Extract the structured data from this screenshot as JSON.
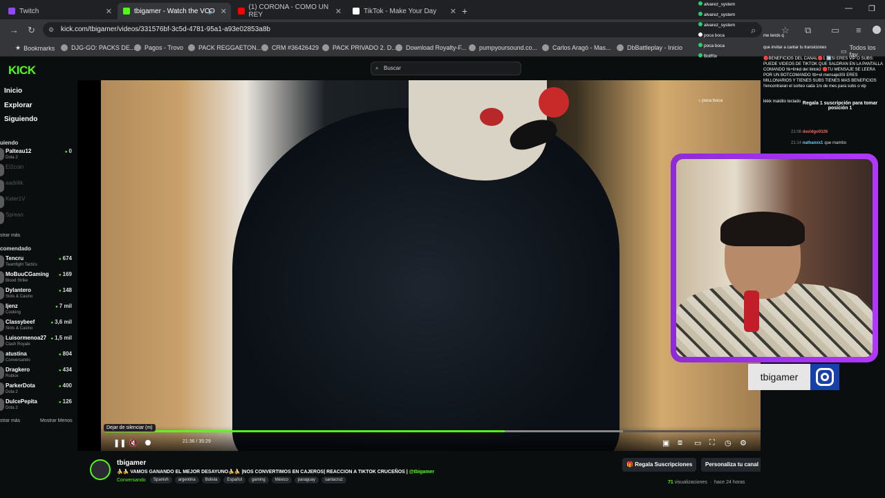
{
  "tabs": [
    {
      "label": "Twitch",
      "color": "#9146ff"
    },
    {
      "label": "tbigamer - Watch the VOD",
      "color": "#53fc18"
    },
    {
      "label": "(1) CORONA - COMO UN REY",
      "color": "#ff0000"
    },
    {
      "label": "TikTok - Make Your Day",
      "color": "#ffffff"
    }
  ],
  "address": {
    "url": "kick.com/tbigamer/videos/331576bf-3c5d-4781-95a1-a93e02853a8b"
  },
  "bookmarks": [
    "Bookmarks",
    "DJG-GO: PACKS DE...",
    "Pagos - Trovo",
    "PACK REGGAETON...",
    "CRM #36426429",
    "PACK PRIVADO 2. D...",
    "Download Royalty-F...",
    "pumpyoursound.co...",
    "Carlos Aragó - Mas...",
    "DbBattleplay - Inicio",
    "Todos los fav"
  ],
  "kick": {
    "logo": "KICK",
    "search_placeholder": "Buscar"
  },
  "sidebar": {
    "nav": [
      "Inicio",
      "Explorar",
      "Siguiendo"
    ],
    "following_header": "uiendo",
    "following": [
      {
        "name": "Palteau12",
        "game": "Dota 2",
        "viewers": "0",
        "live": true
      },
      {
        "name": "El2coin",
        "game": "",
        "viewers": "",
        "live": false
      },
      {
        "name": "aadrillk",
        "game": "",
        "viewers": "",
        "live": false
      },
      {
        "name": "Keler1V",
        "game": "",
        "viewers": "",
        "live": false
      },
      {
        "name": "Sprean",
        "game": "",
        "viewers": "",
        "live": false
      }
    ],
    "show_more_1": "strar más",
    "recommended_header": "comendado",
    "recommended": [
      {
        "name": "Tencru",
        "game": "Teamfight Tactics",
        "viewers": "674"
      },
      {
        "name": "MoBuuCGaming",
        "game": "Blood Strike",
        "viewers": "169"
      },
      {
        "name": "Dylantero",
        "game": "Slots & Casino",
        "viewers": "148"
      },
      {
        "name": "ljenz",
        "game": "Cooking",
        "viewers": "7 mil"
      },
      {
        "name": "Classybeef",
        "game": "Slots & Casino",
        "viewers": "3,6 mil"
      },
      {
        "name": "Luisormenoa27",
        "game": "Clash Royale",
        "viewers": "1,5 mil"
      },
      {
        "name": "atustina",
        "game": "Conversando",
        "viewers": "804"
      },
      {
        "name": "Dragkero",
        "game": "Roblox",
        "viewers": "434"
      },
      {
        "name": "ParkerDota",
        "game": "Dota 2",
        "viewers": "400"
      },
      {
        "name": "DulcePepita",
        "game": "Dota 2",
        "viewers": "126"
      }
    ],
    "show_more_2": "strar más",
    "show_less": "Mostrar Menos"
  },
  "player": {
    "tooltip": "Dejar de silenciar (m)",
    "time": "21:36 / 35:29",
    "progress": 0.61,
    "buffered": 0.18
  },
  "stream": {
    "channel": "tbigamer",
    "title": "🍌🍌 VAMOS GANANDO EL MEJOR DESAYUNO🍌🍌 |NOS CONVERTIMOS EN CAJEROS| REACCION A TIKTOK CRUCEÑOS | ",
    "title_tag": "@tbigamer",
    "category": "Conversando",
    "tags": [
      "Spanish",
      "argentina",
      "Bolivia",
      "Español",
      "gaming",
      "México",
      "paraguay",
      "santacruz"
    ],
    "btn_gift": "Regala Suscripciones",
    "btn_personalize": "Personaliza tu canal",
    "views_count": "71",
    "views_label": "visualizaciones",
    "ago": "hace 24 horas"
  },
  "overlay": {
    "users": [
      "alvarez_system",
      "alvarez_system",
      "alvarez_system",
      "poca boca",
      "poca boca",
      "BotRix"
    ],
    "msg_top": "me tends q",
    "msg_invite": "que invitar a cantar tu transiciones",
    "benefits": "🔴BENEFICIOS DEL CANAL🔴1 ➡️SI ERES VIP O SUBS: PUEDE VIDEOS DE TIKTOK QUE SALDRAN EN LA PANTALLA COMANDO !tk+linkd del tiktok2 🔴TU MENSAJE SE LEERA POR UN BOTCOMANDO !tb+el mensaje3SI ERES MILLONARIOS Y TIENES SUBS TIENES MAS BENEFICIOS !!encontraran el sorteo cada 1ro de mes para subs o vip",
    "msg_keyboard": "kkkk maldito teclado",
    "tiktok_user": "poca boca",
    "pin": "Regala 1 suscripción para tomar posición 1",
    "chat": [
      {
        "time": "21:08",
        "user": "davidgo0326",
        "text": ""
      },
      {
        "time": "21:14",
        "user": "nathanxx1",
        "text": "que mambo"
      }
    ]
  },
  "nameplate": {
    "name": "tbigamer"
  }
}
